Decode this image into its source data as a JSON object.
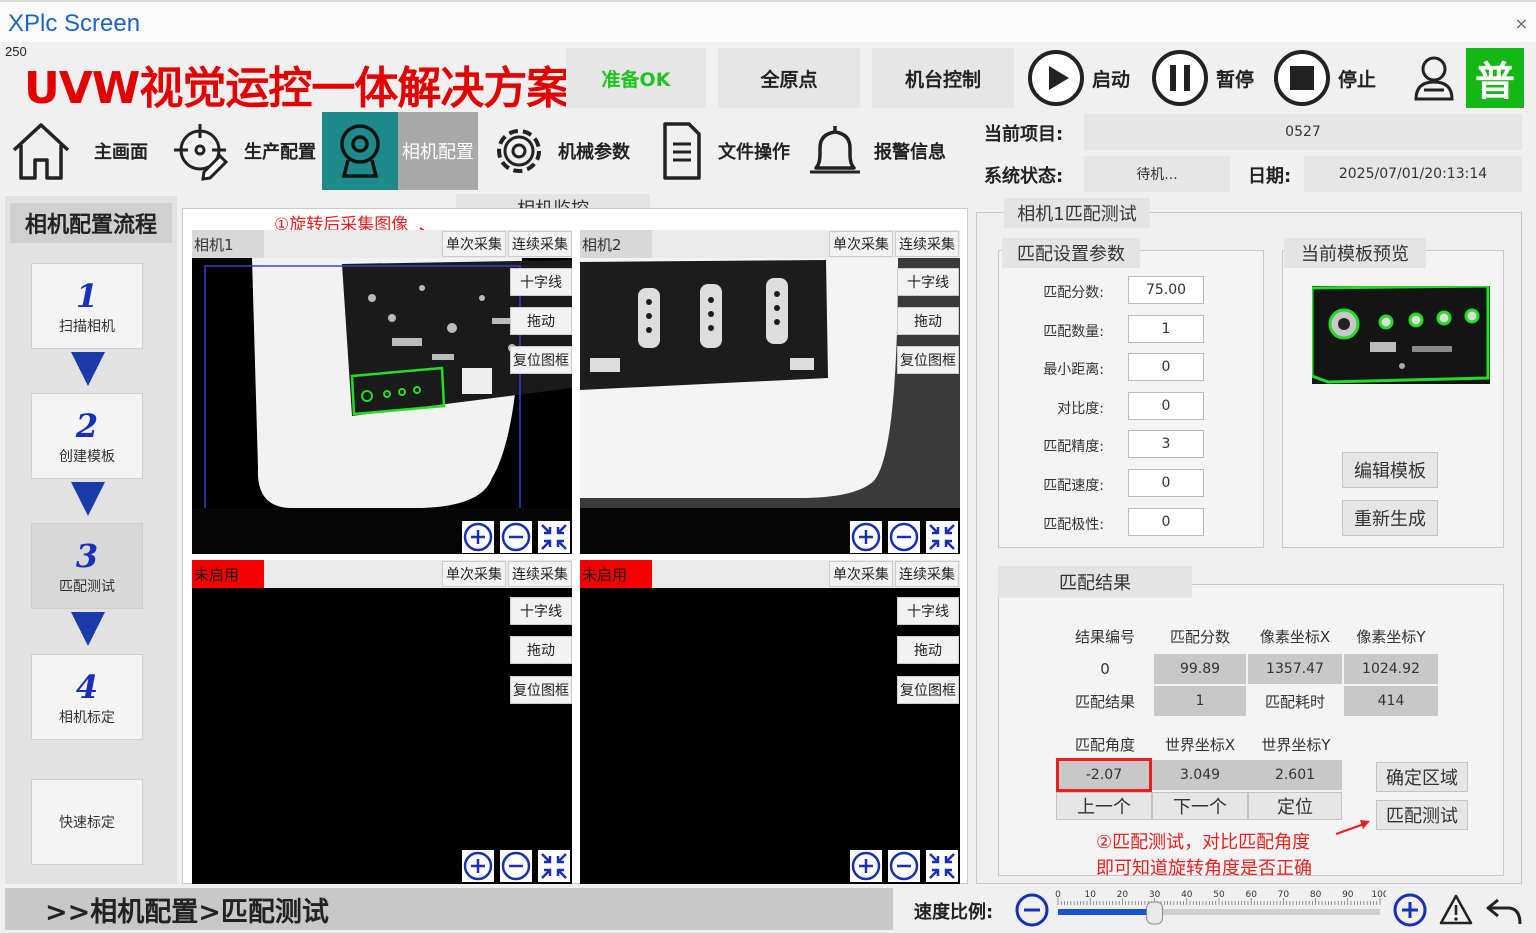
{
  "window": {
    "title": "XPlc Screen",
    "close": "×"
  },
  "counter": "250",
  "brand": "UVW视觉运控一体解决方案",
  "top": {
    "ready": "准备OK",
    "home_all": "全原点",
    "machine_ctrl": "机台控制",
    "start": "启动",
    "pause": "暂停",
    "stop": "停止",
    "level": "普"
  },
  "nav": {
    "home": "主画面",
    "production": "生产配置",
    "camera": "相机配置",
    "mechanical": "机械参数",
    "file": "文件操作",
    "alarm": "报警信息"
  },
  "info": {
    "project_label": "当前项目:",
    "project_value": "0527",
    "status_label": "系统状态:",
    "status_value": "待机...",
    "date_label": "日期:",
    "date_value": "2025/07/01/20:13:14"
  },
  "flow": {
    "title": "相机配置流程",
    "steps": [
      {
        "num": "1",
        "label": "扫描相机"
      },
      {
        "num": "2",
        "label": "创建模板"
      },
      {
        "num": "3",
        "label": "匹配测试"
      },
      {
        "num": "4",
        "label": "相机标定"
      }
    ],
    "quick": "快速标定"
  },
  "monitor": {
    "title": "相机监控",
    "annotation": "①旋转后采集图像",
    "single": "单次采集",
    "continuous": "连续采集",
    "crosshair": "十字线",
    "drag": "拖动",
    "reset": "复位图框",
    "cams": [
      {
        "name": "相机1"
      },
      {
        "name": "相机2"
      },
      {
        "name": "未启用"
      },
      {
        "name": "未启用"
      }
    ]
  },
  "match": {
    "title": "相机1匹配测试",
    "params_title": "匹配设置参数",
    "params": [
      {
        "label": "匹配分数:",
        "value": "75.00"
      },
      {
        "label": "匹配数量:",
        "value": "1"
      },
      {
        "label": "最小距离:",
        "value": "0"
      },
      {
        "label": "对比度:",
        "value": "0"
      },
      {
        "label": "匹配精度:",
        "value": "3"
      },
      {
        "label": "匹配速度:",
        "value": "0"
      },
      {
        "label": "匹配极性:",
        "value": "0"
      }
    ],
    "preview_title": "当前模板预览",
    "edit_template": "编辑模板",
    "regenerate": "重新生成",
    "result_title": "匹配结果",
    "headers1": [
      "结果编号",
      "匹配分数",
      "像素坐标X",
      "像素坐标Y"
    ],
    "row1": [
      "0",
      "99.89",
      "1357.47",
      "1024.92"
    ],
    "match_result_label": "匹配结果",
    "match_result_value": "1",
    "match_time_label": "匹配耗时",
    "match_time_value": "414",
    "headers2": [
      "匹配角度",
      "世界坐标X",
      "世界坐标Y"
    ],
    "row2": [
      "-2.07",
      "3.049",
      "2.601"
    ],
    "prev": "上一个",
    "next": "下一个",
    "locate": "定位",
    "confirm_area": "确定区域",
    "match_test": "匹配测试",
    "annotation_line1": "②匹配测试，对比匹配角度",
    "annotation_line2": "即可知道旋转角度是否正确"
  },
  "bottom": {
    "breadcrumb": ">>相机配置>匹配测试",
    "speed_label": "速度比例:",
    "speed_value": 30,
    "speed_ticks": [
      "0",
      "10",
      "20",
      "30",
      "40",
      "50",
      "60",
      "70",
      "80",
      "90",
      "100"
    ]
  }
}
